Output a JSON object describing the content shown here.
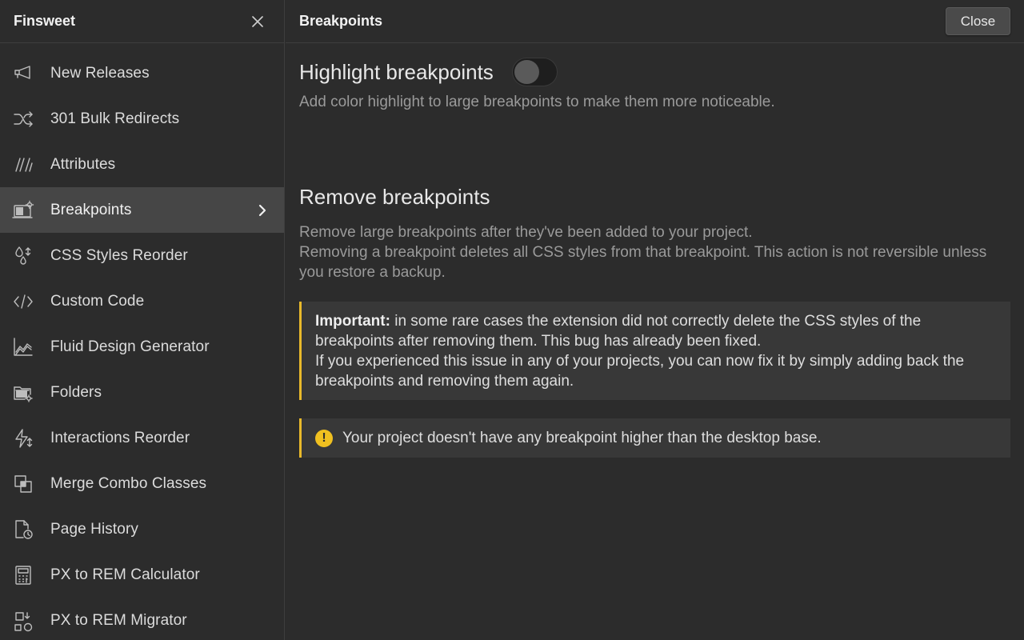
{
  "sidebar": {
    "brand": "Finsweet",
    "items": [
      {
        "label": "New Releases",
        "icon": "megaphone-icon"
      },
      {
        "label": "301 Bulk Redirects",
        "icon": "shuffle-icon"
      },
      {
        "label": "Attributes",
        "icon": "attributes-icon"
      },
      {
        "label": "Breakpoints",
        "icon": "breakpoints-icon",
        "active": true
      },
      {
        "label": "CSS Styles Reorder",
        "icon": "drops-reorder-icon"
      },
      {
        "label": "Custom Code",
        "icon": "code-icon"
      },
      {
        "label": "Fluid Design Generator",
        "icon": "chart-area-icon"
      },
      {
        "label": "Folders",
        "icon": "folder-gear-icon"
      },
      {
        "label": "Interactions Reorder",
        "icon": "lightning-reorder-icon"
      },
      {
        "label": "Merge Combo Classes",
        "icon": "merge-squares-icon"
      },
      {
        "label": "Page History",
        "icon": "page-history-icon"
      },
      {
        "label": "PX to REM Calculator",
        "icon": "calculator-icon"
      },
      {
        "label": "PX to REM Migrator",
        "icon": "migrator-icon"
      }
    ]
  },
  "main": {
    "title": "Breakpoints",
    "close_label": "Close",
    "highlight": {
      "title": "Highlight breakpoints",
      "toggle_on": false,
      "description": "Add color highlight to large breakpoints to make them more noticeable."
    },
    "remove": {
      "title": "Remove breakpoints",
      "description_line1": "Remove large breakpoints after they've been added to your project.",
      "description_line2": "Removing a breakpoint deletes all CSS styles from that breakpoint. This action is not reversible unless you restore a backup."
    },
    "important": {
      "label": "Important:",
      "text1": " in some rare cases the extension did not correctly delete the CSS styles of the breakpoints after removing them. This bug has already been fixed.",
      "text2": "If you experienced this issue in any of your projects, you can now fix it by simply adding back the breakpoints and removing them again."
    },
    "warning": {
      "icon": "exclamation-circle-icon",
      "text": "Your project doesn't have any breakpoint higher than the desktop base."
    }
  },
  "colors": {
    "background": "#2c2c2c",
    "active_item": "#464646",
    "callout_accent": "#e8b92b",
    "warning_icon": "#f0c020"
  }
}
